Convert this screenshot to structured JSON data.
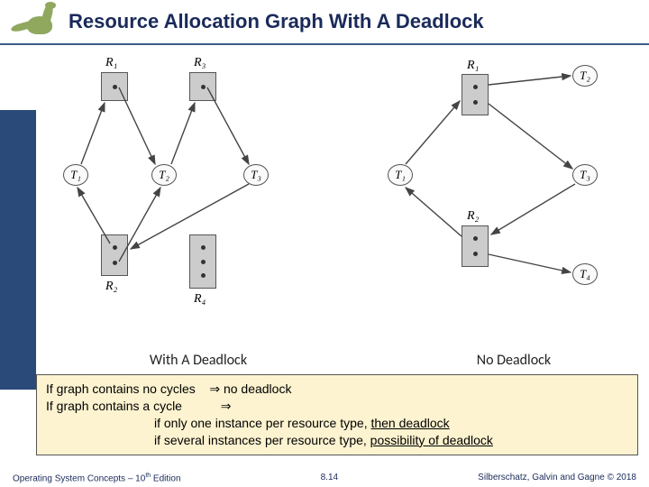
{
  "header": {
    "title": "Resource Allocation Graph With A Deadlock"
  },
  "captions": {
    "left": "With A Deadlock",
    "right": "No Deadlock"
  },
  "infobox": {
    "line1_a": "If graph contains no cycles",
    "line1_b": "no deadlock",
    "line2": "If graph contains a cycle",
    "line3_a": "if only one instance per resource type, ",
    "line3_b": "then deadlock",
    "line4_a": "if several instances per resource type, ",
    "line4_b": "possibility of deadlock",
    "imply": "⇒"
  },
  "footer": {
    "left_a": "Operating System Concepts – 10",
    "left_sup": "th",
    "left_b": " Edition",
    "center": "8.14",
    "right": "Silberschatz, Galvin and Gagne © 2018"
  },
  "diagram_left": {
    "resources": {
      "R1": "R₁",
      "R2": "R₂",
      "R3": "R₃",
      "R4": "R₄"
    },
    "threads": {
      "T1": "T₁",
      "T2": "T₂",
      "T3": "T₃"
    }
  },
  "diagram_right": {
    "resources": {
      "R1": "R₁",
      "R2": "R₂"
    },
    "threads": {
      "T1": "T₁",
      "T2": "T₂",
      "T3": "T₃",
      "T4": "T₄"
    }
  },
  "chart_data": [
    {
      "type": "diagram",
      "title": "With A Deadlock",
      "nodes": {
        "resources": [
          {
            "id": "R1",
            "instances": 1
          },
          {
            "id": "R2",
            "instances": 2
          },
          {
            "id": "R3",
            "instances": 1
          },
          {
            "id": "R4",
            "instances": 3
          }
        ],
        "threads": [
          "T1",
          "T2",
          "T3"
        ]
      },
      "edges": [
        {
          "from": "R1",
          "to": "T2",
          "kind": "assignment"
        },
        {
          "from": "T2",
          "to": "R3",
          "kind": "request"
        },
        {
          "from": "R3",
          "to": "T3",
          "kind": "assignment"
        },
        {
          "from": "T3",
          "to": "R2",
          "kind": "request"
        },
        {
          "from": "R2",
          "to": "T2",
          "kind": "assignment"
        },
        {
          "from": "R2",
          "to": "T1",
          "kind": "assignment"
        },
        {
          "from": "T1",
          "to": "R1",
          "kind": "request"
        }
      ]
    },
    {
      "type": "diagram",
      "title": "No Deadlock",
      "nodes": {
        "resources": [
          {
            "id": "R1",
            "instances": 2
          },
          {
            "id": "R2",
            "instances": 2
          }
        ],
        "threads": [
          "T1",
          "T2",
          "T3",
          "T4"
        ]
      },
      "edges": [
        {
          "from": "R1",
          "to": "T2",
          "kind": "assignment"
        },
        {
          "from": "R1",
          "to": "T3",
          "kind": "assignment"
        },
        {
          "from": "T3",
          "to": "R2",
          "kind": "request"
        },
        {
          "from": "R2",
          "to": "T1",
          "kind": "assignment"
        },
        {
          "from": "R2",
          "to": "T4",
          "kind": "assignment"
        },
        {
          "from": "T1",
          "to": "R1",
          "kind": "request"
        }
      ]
    }
  ]
}
